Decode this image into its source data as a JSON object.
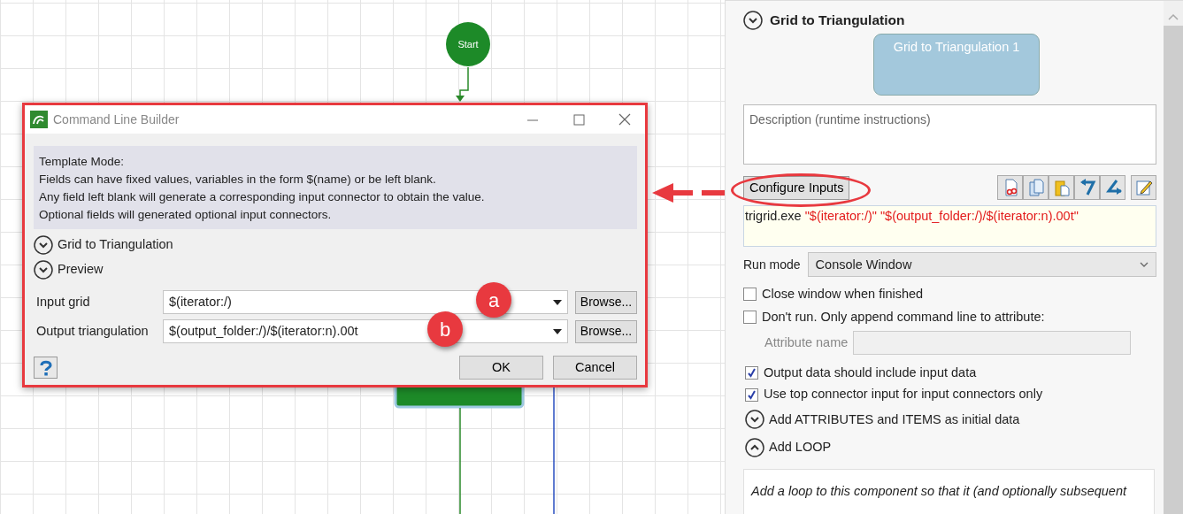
{
  "canvas": {
    "start_node": {
      "label": "Start"
    }
  },
  "dialog": {
    "title": "Command Line Builder",
    "info_lines": [
      "Template Mode:",
      "Fields can have fixed values, variables in the form $(name) or be left blank.",
      "Any field left blank will generate a corresponding input connector to obtain the value.",
      "Optional fields will generated optional input connectors."
    ],
    "sections": [
      {
        "label": "Grid to Triangulation",
        "expanded": false
      },
      {
        "label": "Preview",
        "expanded": false
      }
    ],
    "fields": [
      {
        "label": "Input grid",
        "value": "$(iterator:/)",
        "button": "Browse...",
        "marker": "a"
      },
      {
        "label": "Output triangulation",
        "value": "$(output_folder:/)/$(iterator:n).00t",
        "button": "Browse...",
        "marker": "b"
      }
    ],
    "buttons": [
      "OK",
      "Cancel"
    ]
  },
  "panel": {
    "title": "Grid to Triangulation",
    "node_label": "Grid to Triangulation 1",
    "description_placeholder": "Description (runtime instructions)",
    "configure_button": "Configure Inputs",
    "command": {
      "program": "trigrid.exe",
      "args": [
        "\"$(iterator:/)\"",
        "\"$(output_folder:/)/$(iterator:n).00t\""
      ]
    },
    "run_mode": {
      "label": "Run mode",
      "value": "Console Window"
    },
    "options": [
      {
        "kind": "checkbox",
        "label": "Close window when finished",
        "checked": false
      },
      {
        "kind": "checkbox",
        "label": "Don't run. Only append command line to attribute:",
        "checked": false
      },
      {
        "kind": "field",
        "label": "Attribute name",
        "disabled": true
      },
      {
        "kind": "checkbox",
        "label": "Output data should include input data",
        "checked": true
      },
      {
        "kind": "checkbox",
        "label": "Use top connector input for input connectors only",
        "checked": true
      }
    ],
    "sections": [
      {
        "label": "Add ATTRIBUTES and ITEMS as initial data",
        "expanded": false
      },
      {
        "label": "Add LOOP",
        "expanded": true
      }
    ],
    "loop_description": "Add a loop to this component so that it (and optionally subsequent"
  }
}
